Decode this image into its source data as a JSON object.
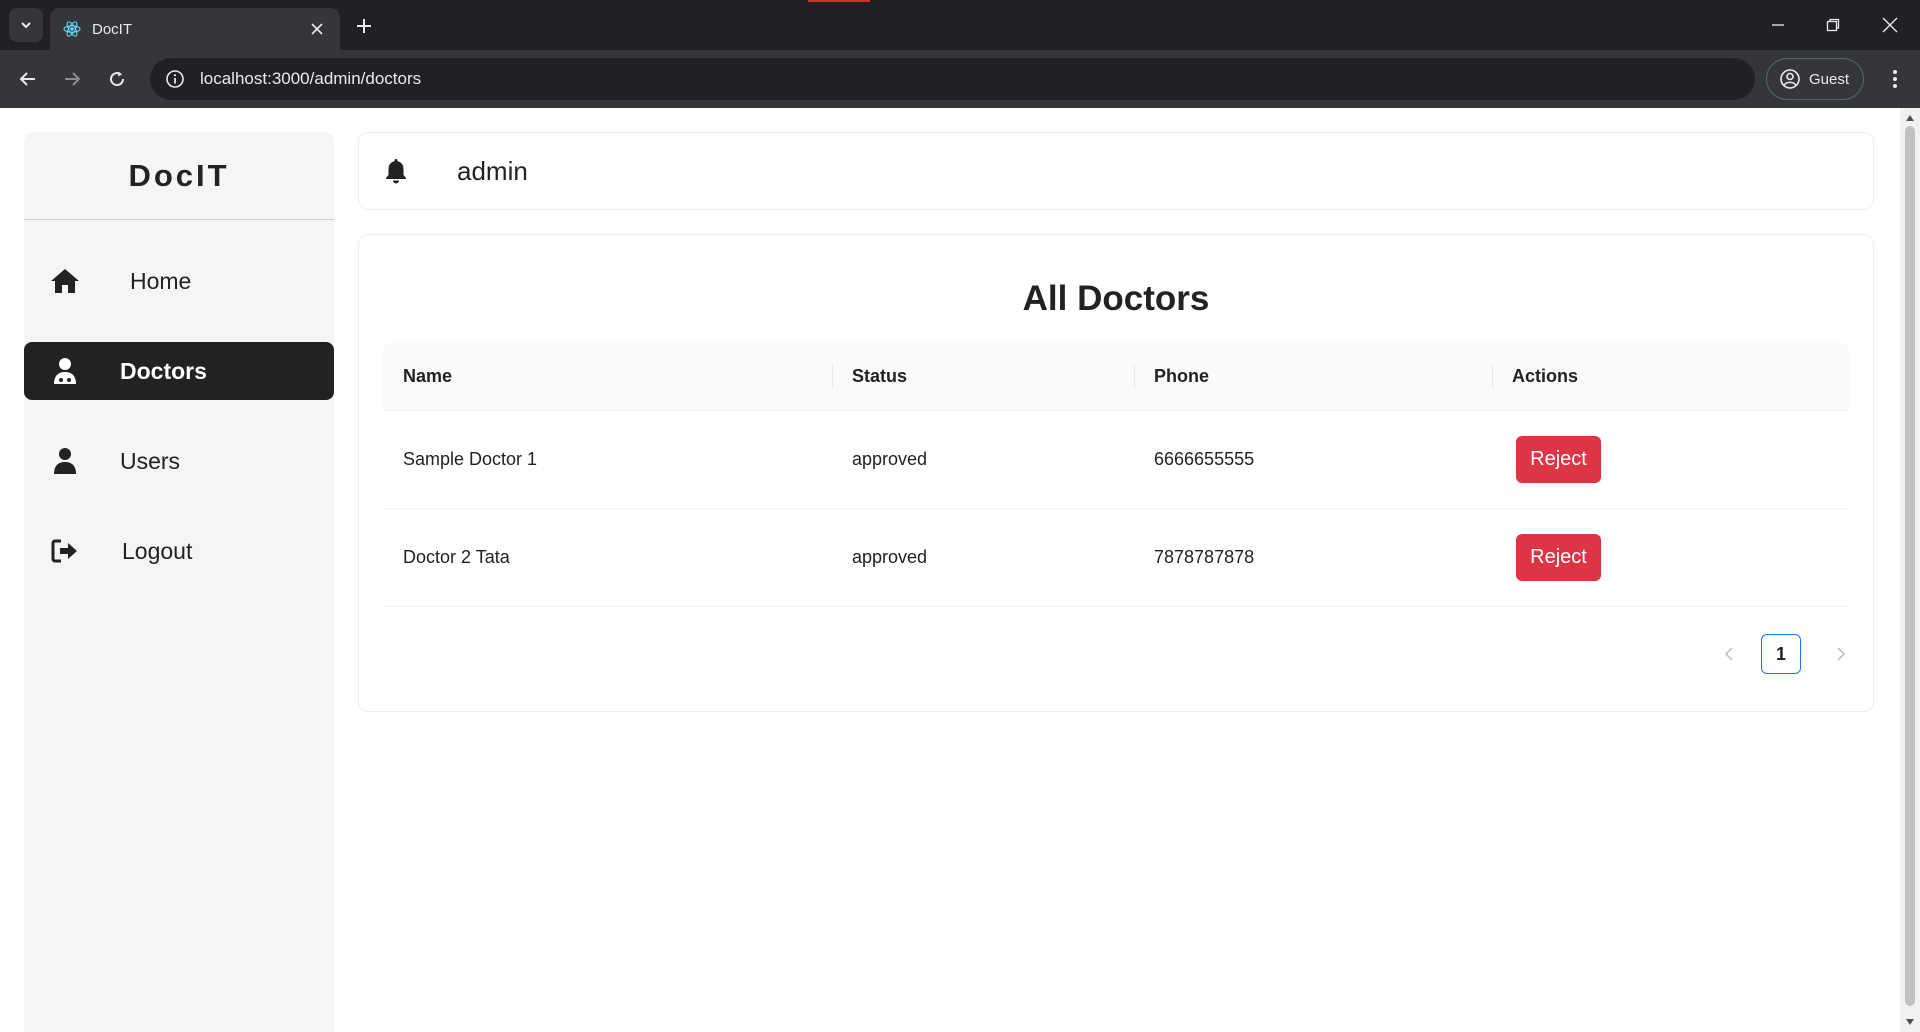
{
  "browser": {
    "tab_title": "DocIT",
    "url": "localhost:3000/admin/doctors",
    "profile_label": "Guest"
  },
  "sidebar": {
    "logo": "DocIT",
    "items": [
      {
        "label": "Home",
        "icon": "home-icon",
        "active": false
      },
      {
        "label": "Doctors",
        "icon": "doctor-icon",
        "active": true
      },
      {
        "label": "Users",
        "icon": "user-icon",
        "active": false
      },
      {
        "label": "Logout",
        "icon": "logout-icon",
        "active": false
      }
    ]
  },
  "header": {
    "user": "admin",
    "icon": "bell-icon"
  },
  "main": {
    "title": "All Doctors",
    "columns": [
      "Name",
      "Status",
      "Phone",
      "Actions"
    ],
    "rows": [
      {
        "name": "Sample Doctor 1",
        "status": "approved",
        "phone": "6666655555",
        "action": "Reject"
      },
      {
        "name": "Doctor 2 Tata",
        "status": "approved",
        "phone": "7878787878",
        "action": "Reject"
      }
    ],
    "pagination": {
      "current_page": "1"
    }
  },
  "colors": {
    "active_nav_bg": "#222222",
    "reject_button": "#dc3545",
    "pagination_accent": "#1677ff"
  }
}
